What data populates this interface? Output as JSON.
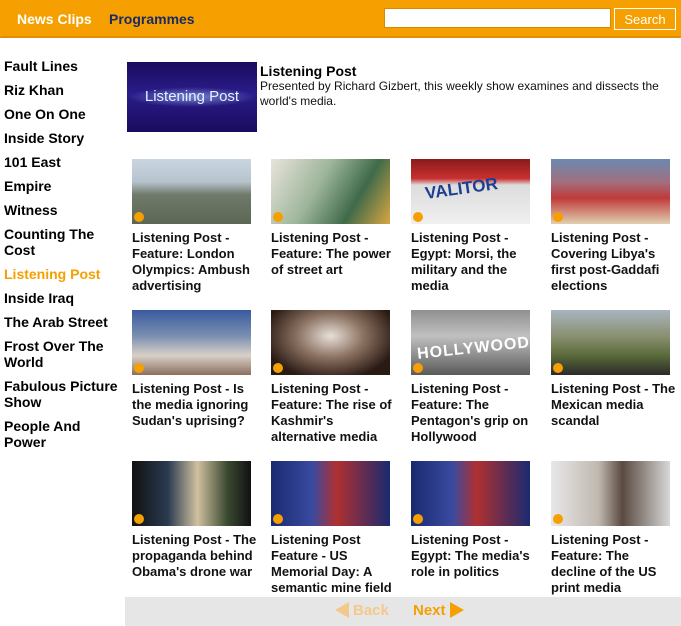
{
  "nav": {
    "news_clips": "News Clips",
    "programmes": "Programmes"
  },
  "search": {
    "value": "",
    "placeholder": "",
    "button_label": "Search"
  },
  "sidebar": {
    "items": [
      {
        "label": "Fault Lines",
        "active": false
      },
      {
        "label": "Riz Khan",
        "active": false
      },
      {
        "label": "One On One",
        "active": false
      },
      {
        "label": "Inside Story",
        "active": false
      },
      {
        "label": "101 East",
        "active": false
      },
      {
        "label": "Empire",
        "active": false
      },
      {
        "label": "Witness",
        "active": false
      },
      {
        "label": "Counting The Cost",
        "active": false
      },
      {
        "label": "Listening Post",
        "active": true
      },
      {
        "label": "Inside Iraq",
        "active": false
      },
      {
        "label": "The Arab Street",
        "active": false
      },
      {
        "label": "Frost Over The World",
        "active": false
      },
      {
        "label": "Fabulous Picture Show",
        "active": false
      },
      {
        "label": "People And Power",
        "active": false
      }
    ]
  },
  "programme": {
    "thumb_text": "Listening Post",
    "title": "Listening Post",
    "description": "Presented by Richard Gizbert, this weekly show examines and dissects the world's media."
  },
  "videos": [
    {
      "title": "Listening Post - Feature: London Olympics: Ambush advertising",
      "thumb_icon": "aerial-city-thumbnail"
    },
    {
      "title": "Listening Post - Feature: The power of street art",
      "thumb_icon": "street-art-thumbnail"
    },
    {
      "title": "Listening Post - Egypt: Morsi, the military and the media",
      "thumb_icon": "valitor-sign-thumbnail",
      "thumb_text": "VALITOR"
    },
    {
      "title": "Listening Post - Covering Libya's first post-Gaddafi elections",
      "thumb_icon": "crowd-thumbnail"
    },
    {
      "title": "Listening Post - Is the media ignoring Sudan's uprising?",
      "thumb_icon": "street-scene-thumbnail"
    },
    {
      "title": "Listening Post - Feature: The rise of Kashmir's alternative media",
      "thumb_icon": "hat-portrait-thumbnail"
    },
    {
      "title": "Listening Post - Feature: The Pentagon's grip on Hollywood",
      "thumb_icon": "hollywood-sign-thumbnail",
      "thumb_text": "HOLLYWOOD"
    },
    {
      "title": "Listening Post - The Mexican media scandal",
      "thumb_icon": "landscape-thumbnail"
    },
    {
      "title": "Listening Post - The propaganda behind Obama's drone war",
      "thumb_icon": "monitors-thumbnail"
    },
    {
      "title": "Listening Post Feature - US Memorial Day: A semantic mine field",
      "thumb_icon": "newsroom-thumbnail"
    },
    {
      "title": "Listening Post - Egypt: The media's role in politics",
      "thumb_icon": "newsroom-thumbnail"
    },
    {
      "title": "Listening Post - Feature: The decline of the US print media",
      "thumb_icon": "interview-thumbnail"
    }
  ],
  "pager": {
    "back_label": "Back",
    "next_label": "Next"
  },
  "colors": {
    "accent": "#f5a000",
    "nav_dark": "#1a2a66"
  }
}
